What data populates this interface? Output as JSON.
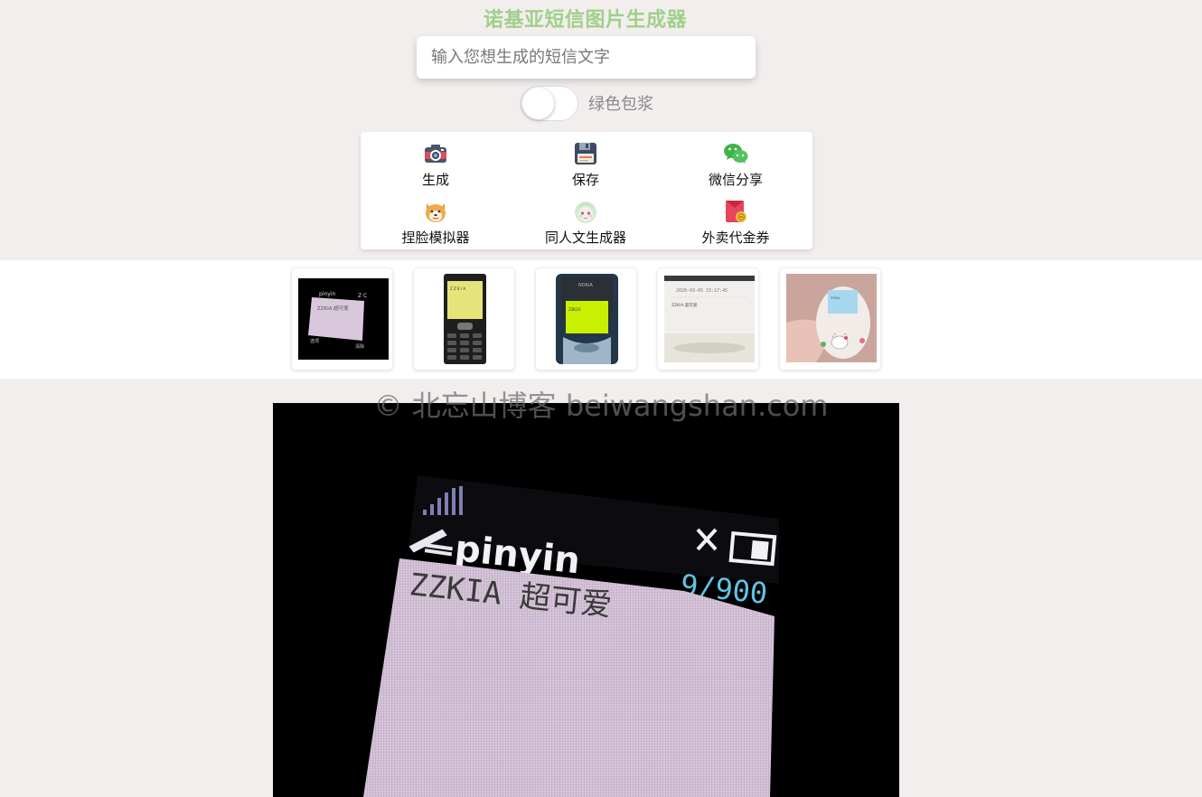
{
  "header": {
    "title": "诺基亚短信图片生成器"
  },
  "input": {
    "placeholder": "输入您想生成的短信文字",
    "value": ""
  },
  "toggle": {
    "label": "绿色包浆",
    "on": false
  },
  "menu": {
    "items": [
      {
        "label": "生成",
        "icon": "camera-icon"
      },
      {
        "label": "保存",
        "icon": "floppy-disk-icon"
      },
      {
        "label": "微信分享",
        "icon": "wechat-icon"
      },
      {
        "label": "捏脸模拟器",
        "icon": "shiba-dog-icon"
      },
      {
        "label": "同人文生成器",
        "icon": "anime-girl-icon"
      },
      {
        "label": "外卖代金券",
        "icon": "red-envelope-icon"
      }
    ]
  },
  "templates": [
    {
      "name": "black-screen-pinyin",
      "selected": true
    },
    {
      "name": "nokia-keypad-phone"
    },
    {
      "name": "nokia-3310-green"
    },
    {
      "name": "receipt-printer"
    },
    {
      "name": "hello-kitty-phone"
    }
  ],
  "watermark": "© 北忘山博客 beiwangshan.com",
  "preview": {
    "input_mode": "pinyin",
    "counter": "9/900",
    "message": "ZZKIA 超可爱"
  },
  "colors": {
    "title": "#9fd08a",
    "page_bg": "#f3eeee",
    "screen": "#d9c8dc",
    "counter": "#5fc4e6"
  }
}
